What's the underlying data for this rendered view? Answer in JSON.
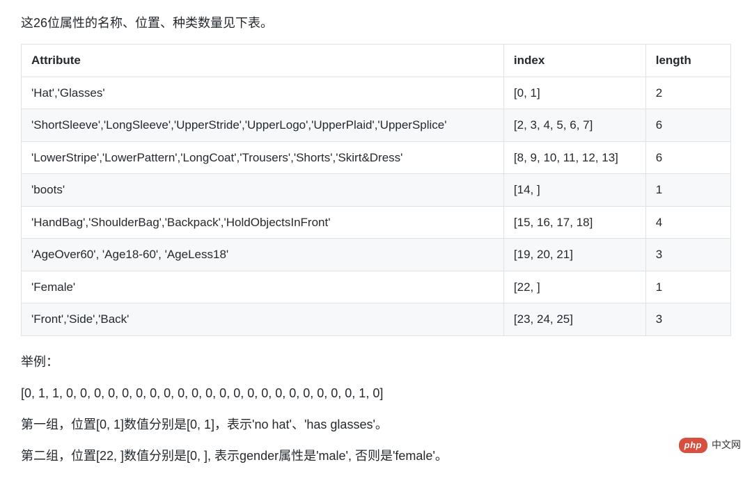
{
  "intro": "这26位属性的名称、位置、种类数量见下表。",
  "table": {
    "headers": {
      "attribute": "Attribute",
      "index": "index",
      "length": "length"
    },
    "rows": [
      {
        "attribute": "'Hat','Glasses'",
        "index": "[0, 1]",
        "length": "2"
      },
      {
        "attribute": "'ShortSleeve','LongSleeve','UpperStride','UpperLogo','UpperPlaid','UpperSplice'",
        "index": "[2, 3, 4, 5, 6, 7]",
        "length": "6"
      },
      {
        "attribute": "'LowerStripe','LowerPattern','LongCoat','Trousers','Shorts','Skirt&Dress'",
        "index": "[8, 9, 10, 11, 12, 13]",
        "length": "6"
      },
      {
        "attribute": "'boots'",
        "index": "[14, ]",
        "length": "1"
      },
      {
        "attribute": "'HandBag','ShoulderBag','Backpack','HoldObjectsInFront'",
        "index": "[15, 16, 17, 18]",
        "length": "4"
      },
      {
        "attribute": "'AgeOver60', 'Age18-60', 'AgeLess18'",
        "index": "[19, 20, 21]",
        "length": "3"
      },
      {
        "attribute": "'Female'",
        "index": "[22, ]",
        "length": "1"
      },
      {
        "attribute": "'Front','Side','Back'",
        "index": "[23, 24, 25]",
        "length": "3"
      }
    ]
  },
  "paragraphs": {
    "p1": "举例：",
    "p2": "[0, 1, 1, 0, 0, 0, 0, 0, 0, 0, 0, 0, 0, 0, 0, 0, 0, 0, 0, 0, 0, 0, 0, 0, 1, 0]",
    "p3": "第一组，位置[0, 1]数值分别是[0, 1]，表示'no hat'、'has glasses'。",
    "p4": "第二组，位置[22, ]数值分别是[0, ], 表示gender属性是'male', 否则是'female'。"
  },
  "watermark": {
    "badge": "php",
    "text": "中文网"
  }
}
